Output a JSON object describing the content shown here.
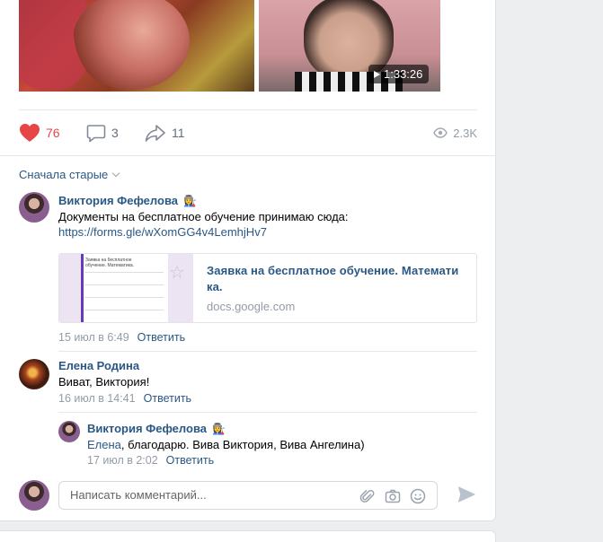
{
  "post": {
    "video_duration": "1:33:26",
    "likes": "76",
    "comments": "3",
    "shares": "11",
    "views": "2.3K"
  },
  "comments_section": {
    "sort_label": "Сначала старые",
    "reply_label": "Ответить",
    "items": [
      {
        "author": "Виктория Фефелова",
        "author_emoji": "👩‍🏭",
        "text": "Документы на бесплатное обучение принимаю сюда:",
        "link": "https://forms.gle/wXomGG4v4LemhjHv7",
        "snippet": {
          "title": "Заявка на бесплатное обучение. Математи ка.",
          "domain": "docs.google.com",
          "thumb_title": "Заявка на бесплатное обучение. Математика."
        },
        "date": "15 июл в 6:49"
      },
      {
        "author": "Елена Родина",
        "text": "Виват, Виктория!",
        "date": "16 июл в 14:41"
      },
      {
        "author": "Виктория Фефелова",
        "author_emoji": "👩‍🏭",
        "mention": "Елена",
        "text": ", благодарю. Вива Виктория, Вива Ангелина)",
        "date": "17 июл в 2:02"
      }
    ]
  },
  "composer": {
    "placeholder": "Написать комментарий..."
  },
  "colors": {
    "link": "#2a5885",
    "like": "#e64646",
    "muted": "#939ca6"
  }
}
